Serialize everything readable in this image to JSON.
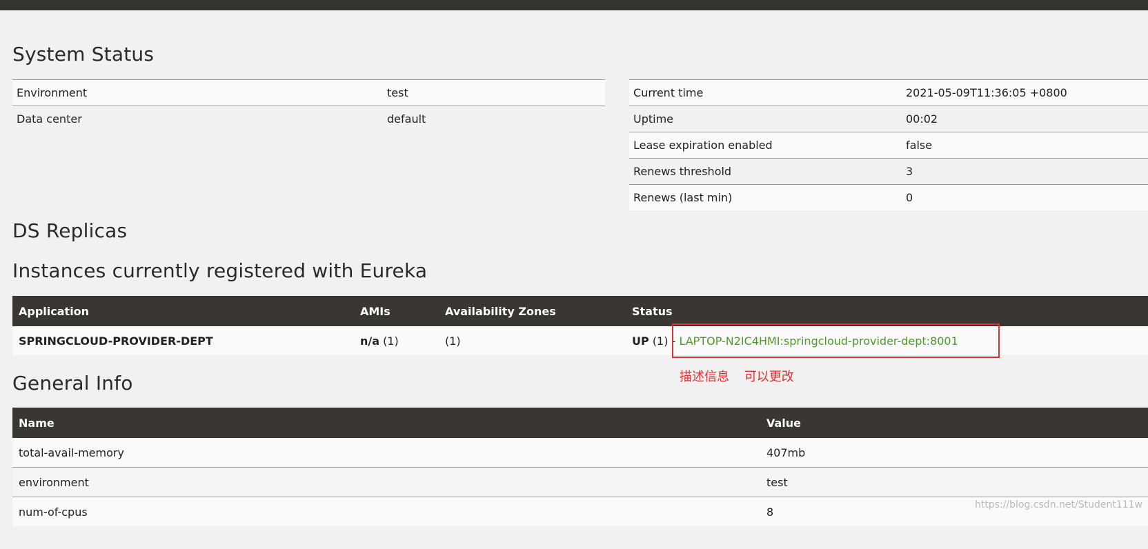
{
  "system_status": {
    "heading": "System Status",
    "left_rows": [
      {
        "key": "Environment",
        "value": "test"
      },
      {
        "key": "Data center",
        "value": "default"
      }
    ],
    "right_rows": [
      {
        "key": "Current time",
        "value": "2021-05-09T11:36:05 +0800"
      },
      {
        "key": "Uptime",
        "value": "00:02"
      },
      {
        "key": "Lease expiration enabled",
        "value": "false"
      },
      {
        "key": "Renews threshold",
        "value": "3"
      },
      {
        "key": "Renews (last min)",
        "value": "0"
      }
    ]
  },
  "ds_replicas": {
    "heading": "DS Replicas"
  },
  "instances": {
    "heading": "Instances currently registered with Eureka",
    "columns": [
      "Application",
      "AMIs",
      "Availability Zones",
      "Status"
    ],
    "rows": [
      {
        "application": "SPRINGCLOUD-PROVIDER-DEPT",
        "amis_bold": "n/a",
        "amis_count": "(1)",
        "zones": "(1)",
        "status_bold": "UP",
        "status_count": "(1) -",
        "instance_link": "LAPTOP-N2IC4HMI:springcloud-provider-dept:8001"
      }
    ]
  },
  "annotation": {
    "part1": "描述信息",
    "part2": "可以更改",
    "color": "#e03030"
  },
  "general_info": {
    "heading": "General Info",
    "columns": [
      "Name",
      "Value"
    ],
    "rows": [
      {
        "name": "total-avail-memory",
        "value": "407mb"
      },
      {
        "name": "environment",
        "value": "test"
      },
      {
        "name": "num-of-cpus",
        "value": "8"
      }
    ]
  },
  "watermark": "https://blog.csdn.net/Student111w",
  "colors": {
    "header_bg": "#3a3733",
    "link": "#4d9a2a",
    "background": "#f1f1f1"
  }
}
